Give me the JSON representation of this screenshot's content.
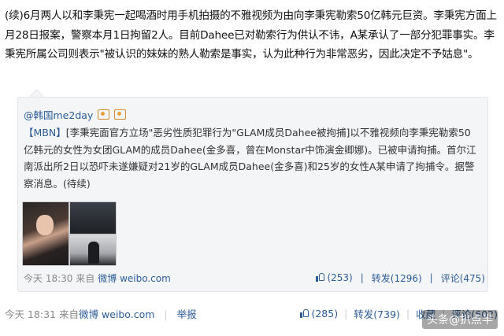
{
  "post": {
    "text": "(续)6月两人以和李秉宪一起喝酒时用手机拍摄的不雅视频为由向李秉宪勒索50亿韩元巨资。李秉宪方面上月28日报案，警察本月1日拘留2人。目前Dahee已对勒索行为供认不讳，A某承认了一部分犯罪事实。李秉宪所属公司则表示\"被认识的妹妹的熟人勒索是事实，认为此种行为非常恶劣，因此决定不予姑息\"。"
  },
  "quote": {
    "author": "@韩国me2day",
    "text_tag": "【MBN】",
    "text": "[李秉宪面官方立场\"恶劣性质犯罪行为\"GLAM成员Dahee被拘捕]以不雅视频向李秉宪勒索50亿韩元的女性为女团GLAM的成员Dahee(金多喜，曾在Monstar中饰演金卿娜)。已被申请拘捕。首尔江南派出所2日以恐吓未遂嫌疑对21岁的GLAM成员Dahee(金多喜)和25岁的女性A某申请了拘捕令。据警察消息。(待续)",
    "meta": {
      "time": "今天 18:30",
      "source_prefix": "来自",
      "source": "微博 weibo.com",
      "like_count": "(253)",
      "repost_label": "转发(1296)",
      "comment_label": "评论(475)"
    }
  },
  "footer": {
    "time": "今天 18:31",
    "source_prefix": "来自",
    "source": "微博 weibo.com",
    "report": "举报",
    "like_count": "(285)",
    "repost_label": "转发(739)",
    "comment_label": "收藏",
    "comment_count": "评论(602)"
  },
  "watermark": "头条@扒点半"
}
